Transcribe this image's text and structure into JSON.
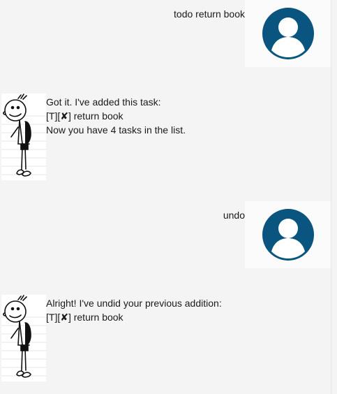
{
  "messages": [
    {
      "role": "user",
      "lines": [
        "todo return book"
      ]
    },
    {
      "role": "bot",
      "lines": [
        "Got it. I've added this task:",
        "[T][✘] return book",
        "Now you have 4 tasks in the list."
      ]
    },
    {
      "role": "user",
      "lines": [
        "undo"
      ]
    },
    {
      "role": "bot",
      "lines": [
        "Alright! I've undid your previous addition:",
        "[T][✘] return book"
      ]
    }
  ],
  "colors": {
    "user_avatar": "#0a5480",
    "background": "#f4f4f4"
  },
  "icons": {
    "user_avatar": "user-avatar-icon",
    "bot_avatar": "wimpy-kid-avatar-icon"
  }
}
